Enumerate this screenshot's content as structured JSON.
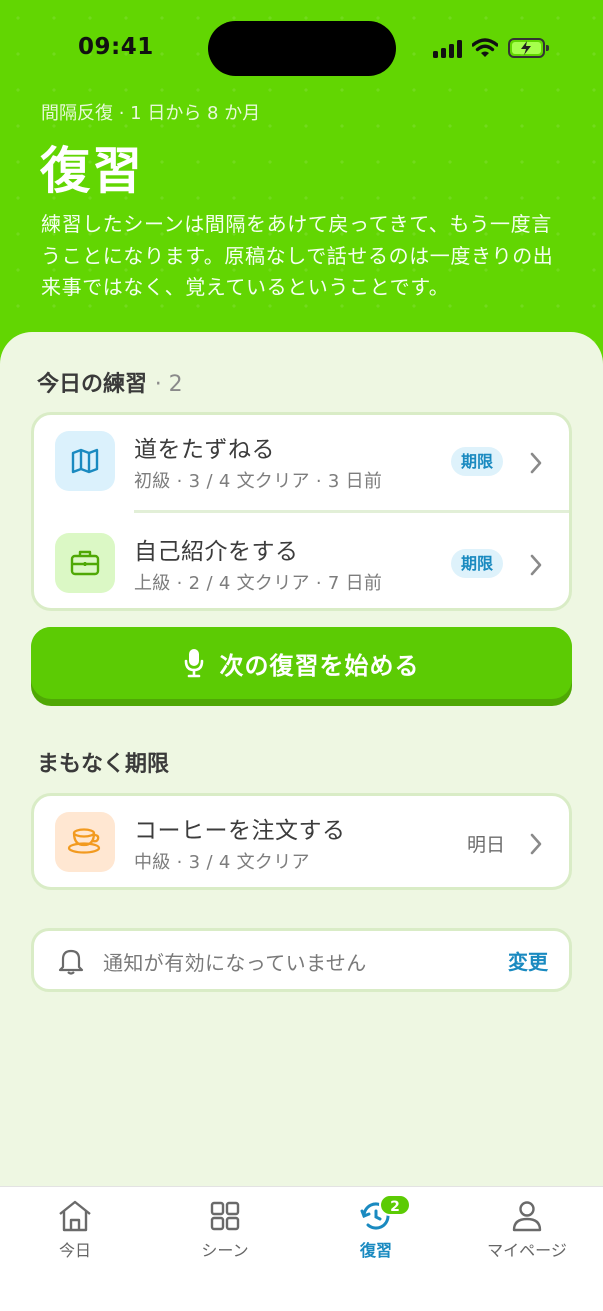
{
  "status_bar": {
    "time": "09:41"
  },
  "header": {
    "eyebrow": "間隔反復 · 1 日から 8 か月",
    "title": "復習",
    "intro": "練習したシーンは間隔をあけて戻ってきて、もう一度言うことになります。原稿なしで話せるのは一度きりの出来事ではなく、覚えているということです。"
  },
  "today": {
    "title": "今日の練習",
    "count": "· 2",
    "items": [
      {
        "name": "道をたずねる",
        "meta": "初級 · 3 / 4 文クリア · 3 日前",
        "badge": "期限",
        "icon": "map-icon"
      },
      {
        "name": "自己紹介をする",
        "meta": "上級 · 2 / 4 文クリア · 7 日前",
        "badge": "期限",
        "icon": "briefcase-icon"
      }
    ]
  },
  "cta": {
    "label": "次の復習を始める",
    "icon": "microphone-icon"
  },
  "upcoming": {
    "title": "まもなく期限",
    "items": [
      {
        "name": "コーヒーを注文する",
        "meta": "中級 · 3 / 4 文クリア",
        "due": "明日",
        "icon": "coffee-cup-icon"
      }
    ]
  },
  "notice": {
    "text": "通知が有効になっていません",
    "action": "変更",
    "icon": "bell-icon"
  },
  "tabs": [
    {
      "label": "今日",
      "icon": "home-icon"
    },
    {
      "label": "シーン",
      "icon": "grid-icon"
    },
    {
      "label": "復習",
      "icon": "review-refresh-icon",
      "badge": "2",
      "active": true
    },
    {
      "label": "マイページ",
      "icon": "person-icon"
    }
  ],
  "colors": {
    "brand_green": "#62d602",
    "accent_blue": "#1a8ac0",
    "background": "#eef7e2"
  }
}
